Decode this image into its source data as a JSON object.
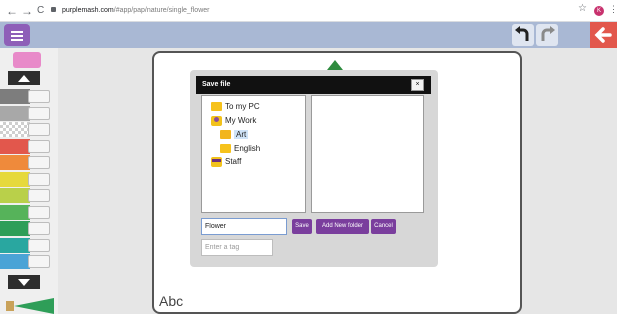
{
  "browser": {
    "back_glyph": "←",
    "forward_glyph": "→",
    "reload_glyph": "C",
    "url_host": "purplemash.com",
    "url_path": "/#app/pap/nature/single_flower",
    "star_glyph": "☆",
    "avatar_letter": "K",
    "menu_glyph": "⋮"
  },
  "dialog": {
    "title": "Save file",
    "close_label": "×",
    "tree": [
      {
        "label": "To my PC",
        "icon": "folder-icon"
      },
      {
        "label": "My Work",
        "icon": "user-folder-icon"
      },
      {
        "label": "Art",
        "icon": "folder-open-icon",
        "selected": true
      },
      {
        "label": "English",
        "icon": "folder-icon"
      },
      {
        "label": "Staff",
        "icon": "staff-icon"
      }
    ],
    "filename_value": "Flower",
    "tag_placeholder": "Enter a tag",
    "save_label": "Save",
    "add_folder_label": "Add New folder",
    "cancel_label": "Cancel"
  },
  "canvas": {
    "text_tool_label": "Abc"
  },
  "colors": {
    "toolbar": "#a9b8d4",
    "menu_button": "#8e5fb8",
    "back_button": "#e2574c",
    "dialog_button": "#7a3e9d",
    "pens": [
      "#7d7d7d",
      "#a8a8a8",
      "#d0d0d0",
      "#e2574c",
      "#ef8a3b",
      "#e6d93c",
      "#b9d04a",
      "#56b35a",
      "#2e9e58",
      "#29a7a0",
      "#4aa3d6"
    ]
  }
}
